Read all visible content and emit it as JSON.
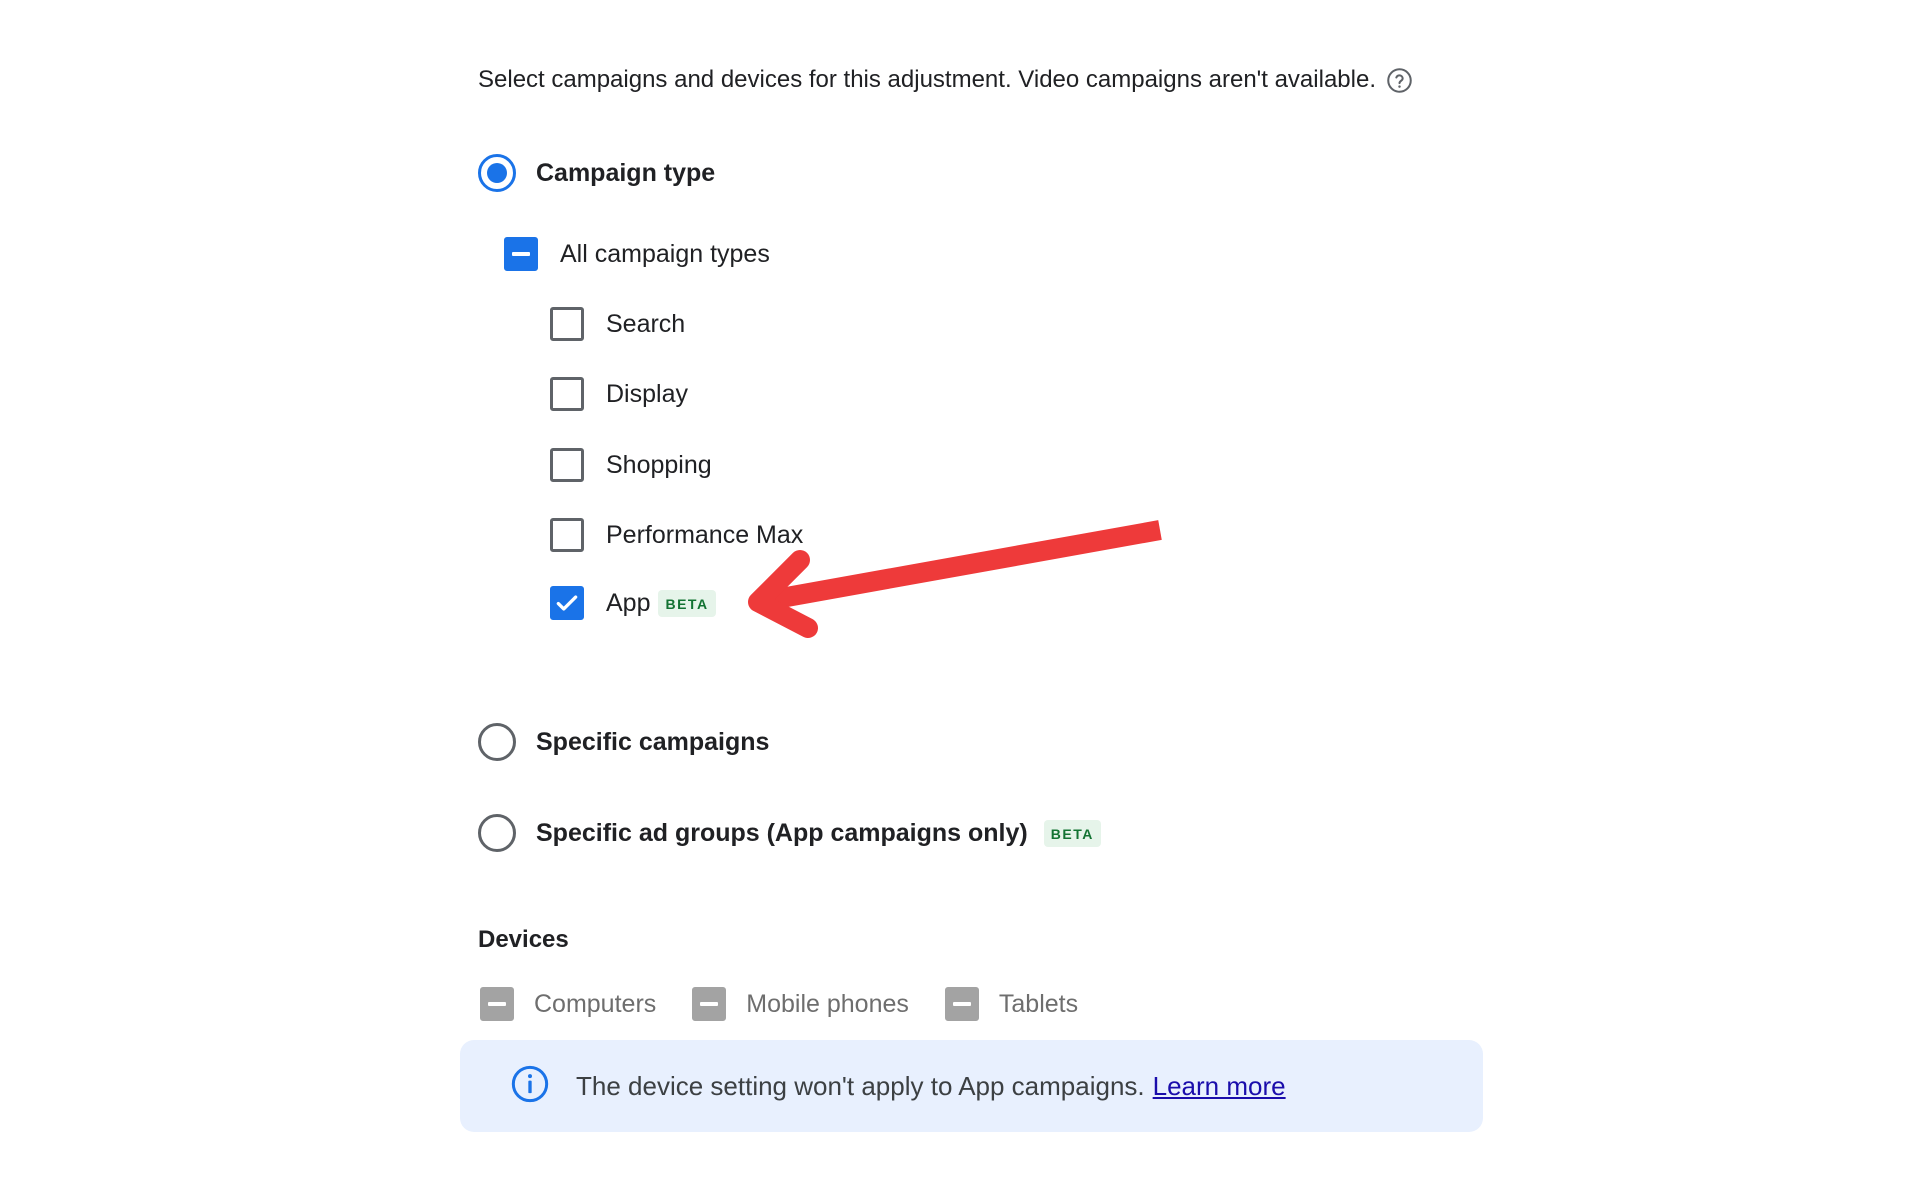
{
  "intro": {
    "text": "Select campaigns and devices for this adjustment. Video campaigns aren't available.",
    "help_icon": "help-circle-icon"
  },
  "scope": {
    "campaign_type": {
      "label": "Campaign type",
      "selected": true
    },
    "specific_campaigns": {
      "label": "Specific campaigns",
      "selected": false
    },
    "specific_ad_groups": {
      "label": "Specific ad groups (App campaigns only)",
      "badge": "BETA",
      "selected": false
    }
  },
  "campaign_types": {
    "all": {
      "label": "All campaign types",
      "state": "indeterminate"
    },
    "items": [
      {
        "label": "Search",
        "checked": false
      },
      {
        "label": "Display",
        "checked": false
      },
      {
        "label": "Shopping",
        "checked": false
      },
      {
        "label": "Performance Max",
        "checked": false
      },
      {
        "label": "App",
        "checked": true,
        "badge": "BETA"
      }
    ]
  },
  "devices": {
    "title": "Devices",
    "items": [
      {
        "label": "Computers",
        "state": "indeterminate-disabled"
      },
      {
        "label": "Mobile phones",
        "state": "indeterminate-disabled"
      },
      {
        "label": "Tablets",
        "state": "indeterminate-disabled"
      }
    ]
  },
  "info": {
    "icon": "info-icon",
    "text": "The device setting won't apply to App campaigns.",
    "link": "Learn more"
  },
  "annotation": {
    "arrow_color": "#ee3a3a"
  },
  "colors": {
    "accent": "#1a73e8",
    "beta_bg": "#e6f4ea",
    "beta_text": "#137333",
    "info_bg": "#e8f0fe",
    "link": "#1a0dab"
  }
}
